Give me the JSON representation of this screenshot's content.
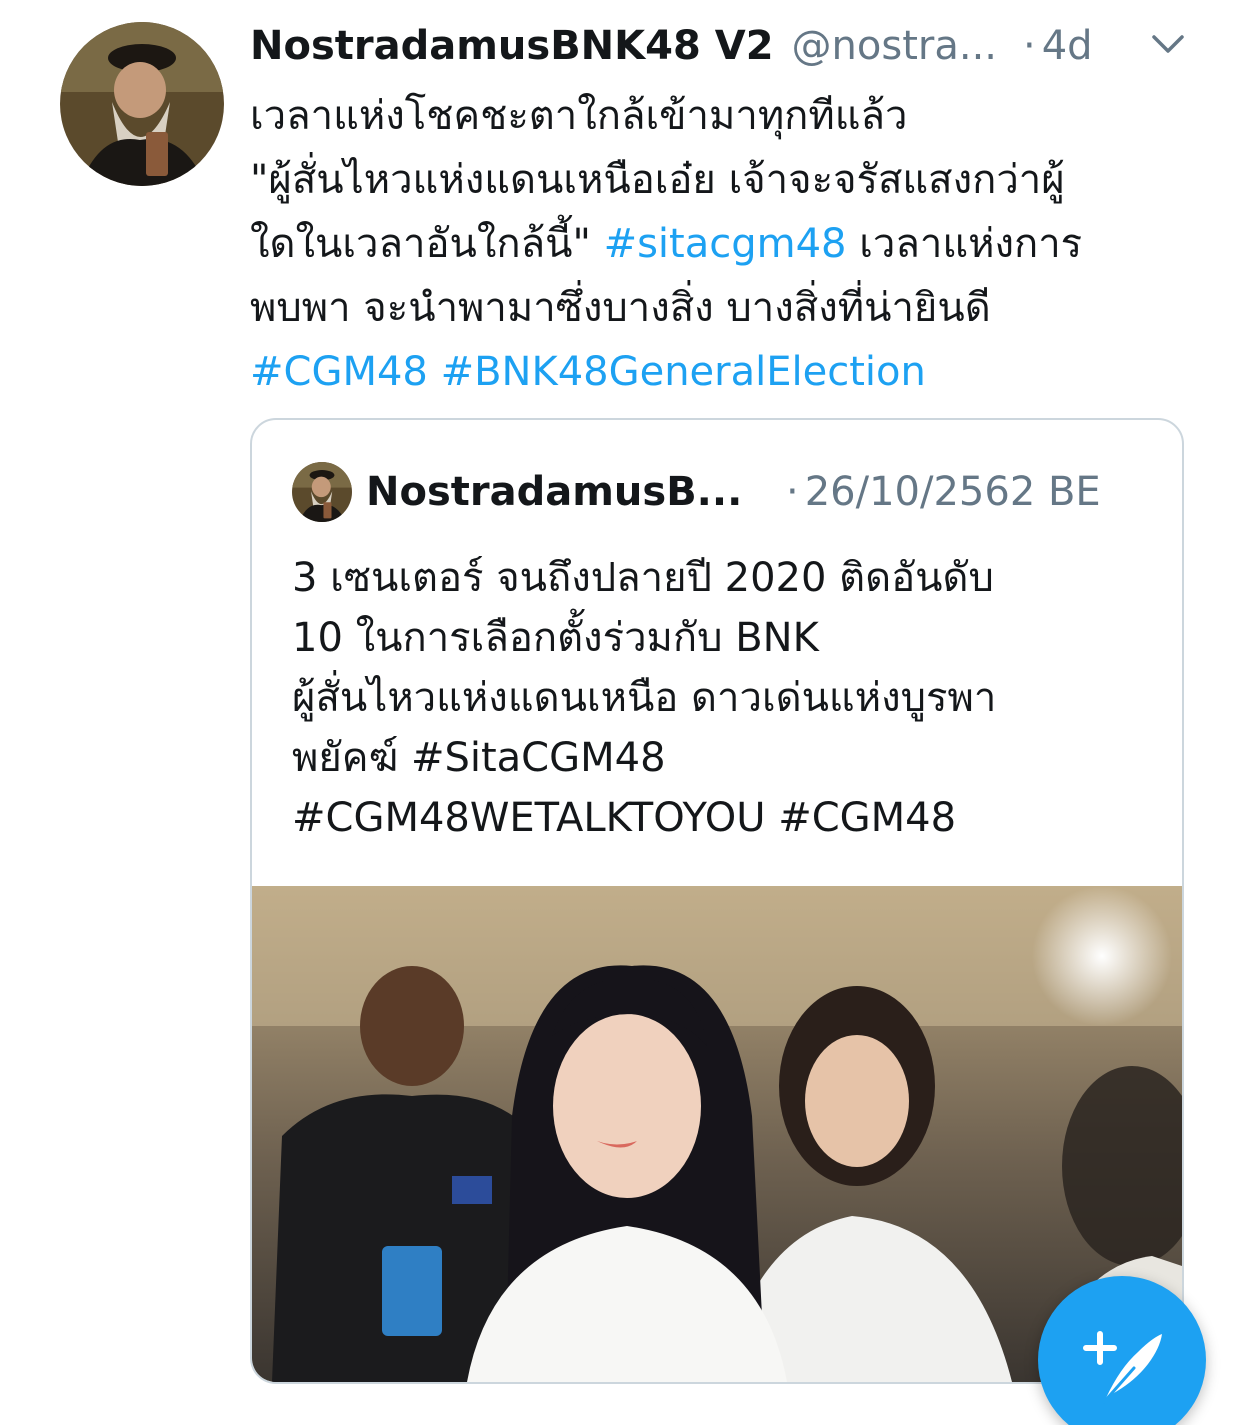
{
  "tweet": {
    "display_name": "NostradamusBNK48 V2",
    "handle": "@nostra...",
    "separator": "·",
    "time": "4d",
    "lines": [
      [
        {
          "text": "เวลาแห่งโชคชะตาใกล้เข้ามาทุกทีแล้ว"
        }
      ],
      [
        {
          "text": "\"ผู้สั่นไหวแห่งแดนเหนือเอ๋ย เจ้าจะจรัสแสงกว่าผู้"
        }
      ],
      [
        {
          "text": "ใดในเวลาอันใกล้นี้\" "
        },
        {
          "text": "#sitacgm48",
          "tag": true
        },
        {
          "text": " เวลาแห่งการ"
        }
      ],
      [
        {
          "text": "พบพา จะนำพามาซึ่งบางสิ่ง บางสิ่งที่น่ายินดี"
        }
      ],
      [
        {
          "text": "#CGM48",
          "tag": true
        },
        {
          "text": " "
        },
        {
          "text": "#BNK48GeneralElection",
          "tag": true
        }
      ]
    ]
  },
  "quote": {
    "name": "NostradamusB...",
    "separator": "·",
    "date": "26/10/2562 BE",
    "lines": [
      "3 เซนเตอร์ จนถึงปลายปี 2020 ติดอันดับ",
      "10 ในการเลือกตั้งร่วมกับ BNK",
      "ผู้สั่นไหวแห่งแดนเหนือ ดาวเด่นแห่งบูรพา",
      "พยัคฆ์ #SitaCGM48",
      "#CGM48WETALKTOYOU  #CGM48"
    ]
  },
  "icons": {
    "menu": "chevron-down-icon",
    "compose": "compose-tweet-icon"
  },
  "colors": {
    "link": "#1da1f2",
    "secondary_text": "#657786",
    "primary_text": "#14171a",
    "border": "#ccd6dd",
    "fab": "#1da1f2"
  }
}
